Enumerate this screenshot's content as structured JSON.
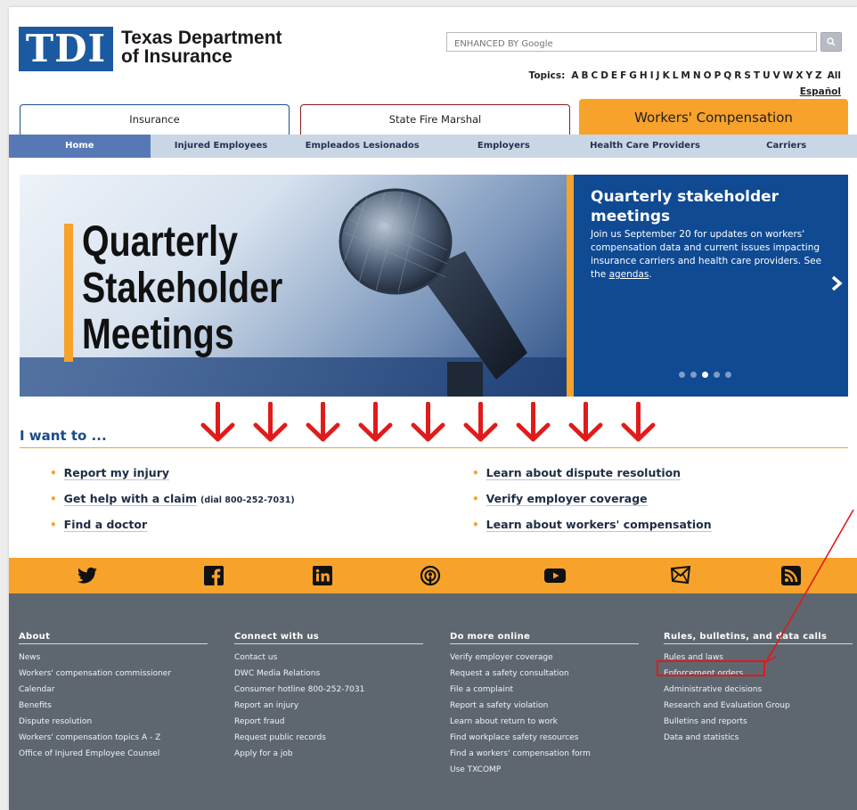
{
  "header": {
    "logo_text": "TDI",
    "org_name_line1": "Texas Department",
    "org_name_line2": "of Insurance",
    "search_placeholder": "ENHANCED BY Google",
    "search_button_icon": "search-icon",
    "topics_label": "Topics:",
    "topics_letters": [
      "A",
      "B",
      "C",
      "D",
      "E",
      "F",
      "G",
      "H",
      "I",
      "J",
      "K",
      "L",
      "M",
      "N",
      "O",
      "P",
      "Q",
      "R",
      "S",
      "T",
      "U",
      "V",
      "W",
      "X",
      "Y",
      "Z",
      "All"
    ],
    "espanol": "Español"
  },
  "section_tabs": {
    "insurance": "Insurance",
    "sfm": "State Fire Marshal",
    "wc": "Workers' Compensation"
  },
  "nav": {
    "items": [
      "Home",
      "Injured Employees",
      "Empleados Lesionados",
      "Employers",
      "Health Care Providers",
      "Carriers"
    ],
    "active": "Home"
  },
  "hero": {
    "image_text_line1": "Quarterly",
    "image_text_line2": "Stakeholder",
    "image_text_line3": "Meetings",
    "panel_title": "Quarterly stakeholder meetings",
    "panel_body": "Join us September 20 for updates on workers' compensation data and current issues impacting insurance carriers and health care providers. See the ",
    "panel_link": "agendas",
    "panel_body_end": ".",
    "next_icon": "chevron-right-icon",
    "dot_count": 5,
    "active_dot": 3
  },
  "iwant": {
    "title": "I want to ...",
    "arrow_count": 9,
    "arrow_color": "#e01b1b",
    "left": [
      {
        "label": "Report my injury",
        "note": ""
      },
      {
        "label": "Get help with a claim",
        "note": "(dial 800-252-7031)"
      },
      {
        "label": "Find a doctor",
        "note": ""
      }
    ],
    "right": [
      {
        "label": "Learn about dispute resolution"
      },
      {
        "label": "Verify employer coverage"
      },
      {
        "label": "Learn about workers' compensation"
      }
    ]
  },
  "social": {
    "icons": [
      "twitter-icon",
      "facebook-icon",
      "linkedin-icon",
      "podcast-icon",
      "youtube-icon",
      "email-icon",
      "rss-icon"
    ]
  },
  "footer": {
    "about": {
      "title": "About",
      "links": [
        "News",
        "Workers' compensation commissioner",
        "Calendar",
        "Benefits",
        "Dispute resolution",
        "Workers' compensation topics A - Z",
        "Office of Injured Employee Counsel"
      ]
    },
    "connect": {
      "title": "Connect with us",
      "links": [
        "Contact us",
        "DWC Media Relations",
        "Consumer hotline 800-252-7031",
        "Report an injury",
        "Report fraud",
        "Request public records",
        "Apply for a job"
      ]
    },
    "more": {
      "title": "Do more online",
      "links": [
        "Verify employer coverage",
        "Request a safety consultation",
        "File a complaint",
        "Report a safety violation",
        "Learn about return to work",
        "Find workplace safety resources",
        "Find a workers' compensation form",
        "Use TXCOMP"
      ]
    },
    "rules": {
      "title": "Rules, bulletins, and data calls",
      "links": [
        "Rules and laws",
        "Enforcement orders",
        "Administrative decisions",
        "Research and Evaluation Group",
        "Bulletins and reports",
        "Data and statistics"
      ]
    }
  },
  "colors": {
    "brand_blue": "#1b5aa0",
    "accent_orange": "#f7a22b",
    "footer_gray": "#5e6770",
    "highlight_red": "#e01b1b"
  }
}
